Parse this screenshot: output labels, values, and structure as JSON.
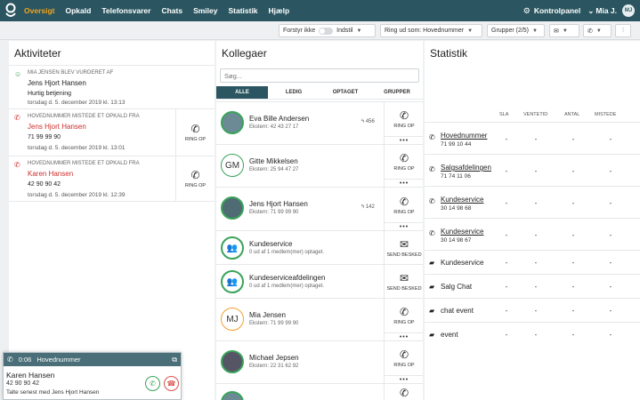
{
  "nav": {
    "items": [
      "Oversigt",
      "Opkald",
      "Telefonsvarer",
      "Chats",
      "Smiley",
      "Statistik",
      "Hjælp"
    ],
    "control_panel": "Kontrolpanel",
    "user_name": "Mia J.",
    "user_initials": "MJ",
    "accent": "#f4a21d",
    "bar_color": "#2b5661"
  },
  "toolbar": {
    "forstyr_label": "Forstyr ikke",
    "indstil_label": "Indstil",
    "ring_ud_label": "Ring ud som: Hovednummer",
    "grupper_label": "Grupper (2/5)"
  },
  "activities": {
    "title": "Aktiviteter",
    "ring_label": "RING OP",
    "items": [
      {
        "header": "MIA JENSEN BLEV VURDERET AF",
        "name": "Jens Hjort Hansen",
        "sub": "Hurtig betjening",
        "date": "torsdag d. 5. december 2019 kl. 13:13"
      },
      {
        "header": "HOVEDNUMMER MISTEDE ET OPKALD FRA",
        "name": "Jens Hjort Hansen",
        "sub": "71 99 99 90",
        "date": "torsdag d. 5. december 2019 kl. 13:01"
      },
      {
        "header": "HOVEDNUMMER MISTEDE ET OPKALD FRA",
        "name": "Karen Hansen",
        "sub": "42 90 90 42",
        "date": "torsdag d. 5. december 2019 kl. 12:39"
      }
    ]
  },
  "colleagues": {
    "title": "Kollegaer",
    "search_placeholder": "Søg...",
    "tabs": [
      "ALLE",
      "LEDIG",
      "OPTAGET",
      "GRUPPER"
    ],
    "ring_label": "RING OP",
    "message_label": "SEND BESKED",
    "more": "•••",
    "items": [
      {
        "name": "Eva Bille Andersen",
        "sub": "Ekstern: 42 43 27 17",
        "ext": "456"
      },
      {
        "name": "Gitte Mikkelsen",
        "sub": "Ekstern: 25 94 47 27",
        "initials": "GM"
      },
      {
        "name": "Jens Hjort Hansen",
        "sub": "Ekstern: 71 99 99 90",
        "ext": "142"
      },
      {
        "name": "Kundeservice",
        "sub": "0 ud af 1 medlem(mer) optaget."
      },
      {
        "name": "Kundeserviceafdelingen",
        "sub": "0 ud af 1 medlem(mer) optaget."
      },
      {
        "name": "Mia Jensen",
        "sub": "Ekstern: 71 99 99 90",
        "initials": "MJ"
      },
      {
        "name": "Michael Jepsen",
        "sub": "Ekstern: 22 31 62 92"
      }
    ]
  },
  "statistics": {
    "title": "Statistik",
    "columns": [
      "SLA",
      "VENTETID",
      "ANTAL",
      "MISTEDE"
    ],
    "dash": "-",
    "rows": [
      {
        "name": "Hovednummer",
        "number": "71 99 10 44"
      },
      {
        "name": "Salgsafdelingen",
        "number": "71 74 11 06"
      },
      {
        "name": "Kundeservice",
        "number": "30 14 98 68"
      },
      {
        "name": "Kundeservice",
        "number": "30 14 98 67"
      },
      {
        "name": "Kundeservice"
      },
      {
        "name": "Salg Chat"
      },
      {
        "name": "chat event"
      },
      {
        "name": "event"
      }
    ]
  },
  "callbox": {
    "timer": "0:06",
    "line": "Hovednummer",
    "name": "Karen Hansen",
    "number": "42 90 90 42",
    "last": "Talte senest med Jens Hjort Hansen"
  }
}
